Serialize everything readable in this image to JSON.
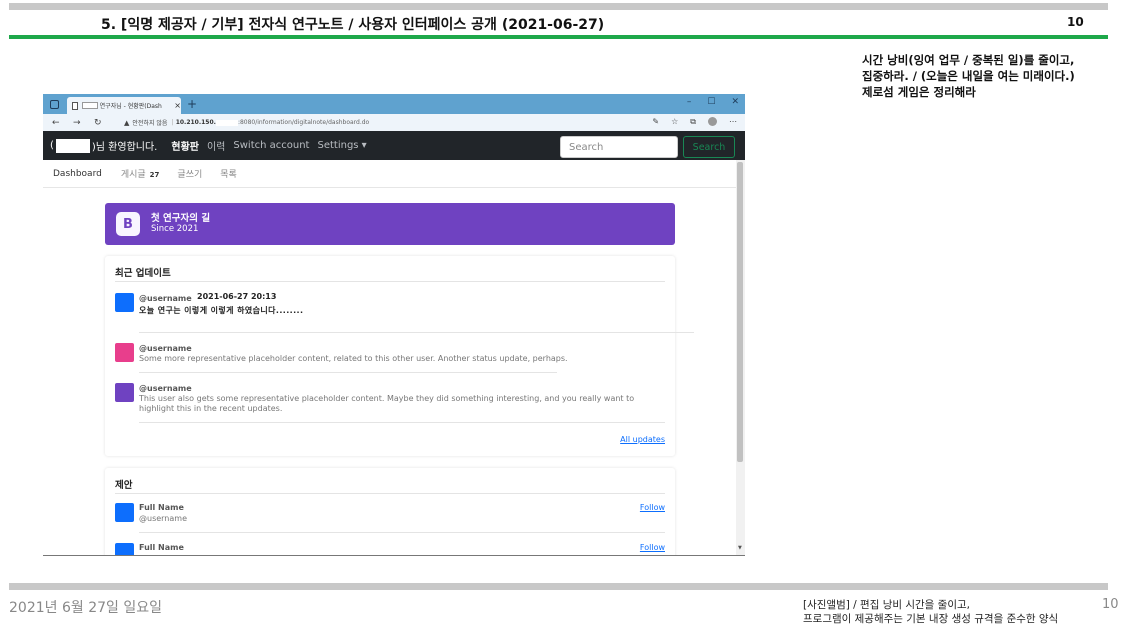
{
  "slide": {
    "title": "5. [익명 제공자 / 기부] 전자식 연구노트 / 사용자 인터페이스 공개 (2021-06-27)",
    "page_number_top": "10",
    "side_note": [
      "시간 낭비(잉여 업무 / 중복된 일)를 줄이고,",
      "집중하라. / (오늘은 내일을 여는 미래이다.)",
      "제로섬 게임은 정리해라"
    ],
    "footer_date": "2021년 6월 27일 일요일",
    "footer_note": [
      "[사진앨범] / 편집 낭비 시간을 줄이고,",
      "프로그램이 제공해주는 기본 내장 생성 규격을 준수한 양식"
    ],
    "page_number_bottom": "10"
  },
  "browser": {
    "tab_title": "연구자님 - 현황판(Dash",
    "tab_close": "×",
    "new_tab": "+",
    "window_controls": [
      "–",
      "☐",
      "✕"
    ],
    "nav_icons": [
      "←",
      "→",
      "↻"
    ],
    "security_warning": "안전하지 않음",
    "url_prefix": "10.210.150.",
    "url_suffix": ":8080/information/digitalnote/dashboard.do",
    "toolbar_icons": [
      "☆",
      "✰",
      "⧉",
      "⋯"
    ]
  },
  "app": {
    "navbar": {
      "welcome_open": "(",
      "welcome_suffix": ")님 환영합니다.",
      "brand": "현황판",
      "links": [
        "이력",
        "Switch account",
        "Settings"
      ],
      "search_placeholder": "Search",
      "search_button": "Search"
    },
    "subnav": {
      "items": [
        "Dashboard",
        "게시글",
        "글쓰기",
        "목록"
      ],
      "post_count": "27"
    },
    "hero": {
      "logo": "B",
      "title": "첫 연구자의 길",
      "subtitle": "Since 2021"
    },
    "recent_updates": {
      "heading": "최근 업데이트",
      "items": [
        {
          "username": "@username",
          "time": "2021-06-27 20:13",
          "text": "오늘 연구는 이렇게 이렇게 하였습니다........",
          "color": "#0d6efd"
        },
        {
          "username": "@username",
          "time": "",
          "text": "Some more representative placeholder content, related to this other user. Another status update, perhaps.",
          "color": "#e83e8c"
        },
        {
          "username": "@username",
          "time": "",
          "text": "This user also gets some representative placeholder content. Maybe they did something interesting, and you really want to highlight this in the recent updates.",
          "color": "#6f42c1"
        }
      ],
      "all_updates_link": "All updates"
    },
    "suggestions": {
      "heading": "제안",
      "items": [
        {
          "name": "Full Name",
          "username": "@username",
          "follow": "Follow",
          "color": "#0d6efd"
        },
        {
          "name": "Full Name",
          "username": "",
          "follow": "Follow",
          "color": "#0d6efd"
        }
      ]
    }
  },
  "colors": {
    "green_rule": "#1ea84a",
    "navbar_bg": "#212529",
    "hero_bg": "#6f42c1",
    "link": "#0d6efd",
    "browser_chrome": "#5fa2cf"
  }
}
